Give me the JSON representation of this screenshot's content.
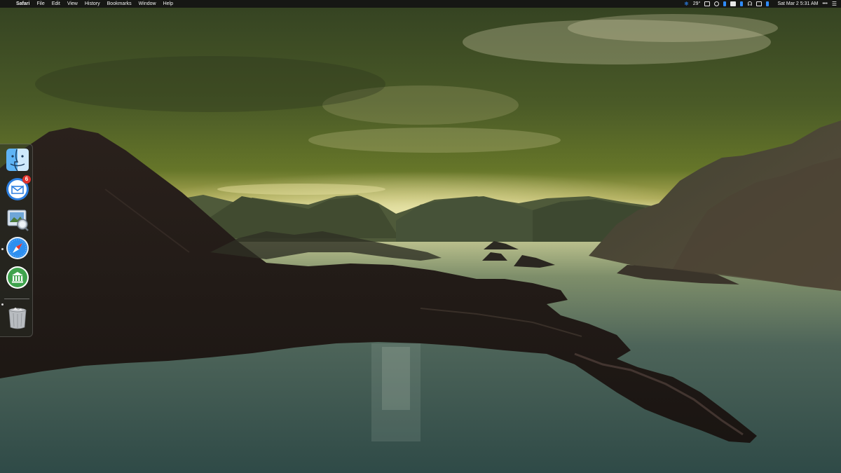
{
  "menubar": {
    "apple_glyph": "",
    "app_name": "Safari",
    "menus": [
      "File",
      "Edit",
      "View",
      "History",
      "Bookmarks",
      "Window",
      "Help"
    ],
    "status": {
      "temperature": "29°",
      "datetime": "Sat Mar 2  5:31 AM"
    },
    "icons": [
      "snowflake-icon",
      "display-icon",
      "target-icon",
      "flag-icon",
      "battery-icon",
      "bluetooth-icon",
      "headphones-icon",
      "screen-icon",
      "spotlight-icon",
      "notification-center-icon"
    ],
    "icon_color": "#2f8cff"
  },
  "dock": {
    "items": [
      {
        "name": "Finder",
        "icon": "finder-icon",
        "running": true
      },
      {
        "name": "Airmail",
        "icon": "mail-icon",
        "running": false,
        "badge": "6"
      },
      {
        "name": "Preview",
        "icon": "preview-icon",
        "running": false
      },
      {
        "name": "Safari",
        "icon": "safari-icon",
        "running": true
      },
      {
        "name": "Banking",
        "icon": "bank-icon",
        "running": false
      },
      {
        "name": "Trash",
        "icon": "trash-icon",
        "running": false
      }
    ],
    "badge_color": "#e0322d"
  },
  "wallpaper": {
    "description_colors": {
      "sky": "#5a6e2a",
      "horizon": "#d8d69a",
      "water": "#3b5550",
      "rock": "#231d19"
    }
  }
}
